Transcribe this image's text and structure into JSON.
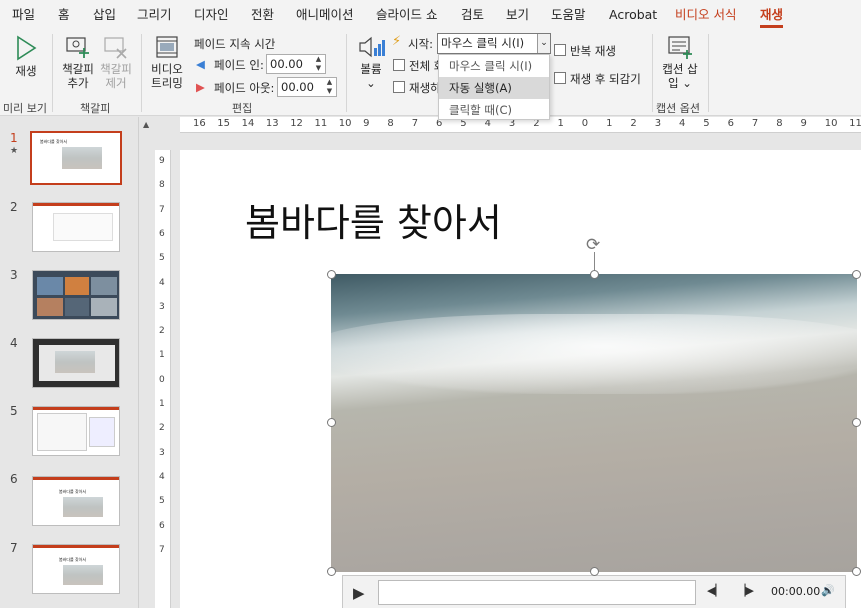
{
  "menu": {
    "tabs": [
      "파일",
      "홈",
      "삽입",
      "그리기",
      "디자인",
      "전환",
      "애니메이션",
      "슬라이드 쇼",
      "검토",
      "보기",
      "도움말",
      "Acrobat"
    ],
    "context_tab": "비디오 서식",
    "active_tab": "재생"
  },
  "ribbon": {
    "preview": {
      "play_label": "재생",
      "group": "미리 보기"
    },
    "bookmarks": {
      "add_label": "책갈피 추가",
      "remove_label": "책갈피 제거",
      "group": "책갈피"
    },
    "editing": {
      "trim_label": "비디오 트리밍",
      "fade_duration_label": "페이드 지속 시간",
      "fade_in_label": "페이드 인:",
      "fade_in_value": "00.00",
      "fade_out_label": "페이드 아웃:",
      "fade_out_value": "00.00",
      "group": "편집"
    },
    "video_options": {
      "volume_label": "볼륨",
      "start_label": "시작:",
      "start_value": "마우스 클릭 시(I)",
      "fullscreen_label": "전체 화",
      "hide_label": "재생하",
      "loop_label": "반복 재생",
      "rewind_label": "재생 후 되감기",
      "dropdown_options": [
        "마우스 클릭 시(I)",
        "자동 실행(A)",
        "클릭할 때(C)"
      ]
    },
    "captions": {
      "insert_label": "캡션 삽입",
      "group": "캡션 옵션"
    }
  },
  "thumbnails": [
    {
      "num": "1",
      "title": "봄바다를 찾아서",
      "selected": true
    },
    {
      "num": "2",
      "title": ""
    },
    {
      "num": "3",
      "title": ""
    },
    {
      "num": "4",
      "title": ""
    },
    {
      "num": "5",
      "title": ""
    },
    {
      "num": "6",
      "title": "봄바다를 찾아서"
    },
    {
      "num": "7",
      "title": "봄바다를 찾아서"
    }
  ],
  "ruler": {
    "h_ticks": [
      "16",
      "15",
      "14",
      "13",
      "12",
      "11",
      "10",
      "9",
      "8",
      "7",
      "6",
      "5",
      "4",
      "3",
      "2",
      "1",
      "0",
      "1",
      "2",
      "3",
      "4",
      "5",
      "6",
      "7",
      "8",
      "9",
      "10",
      "11"
    ],
    "v_ticks": [
      "9",
      "8",
      "7",
      "6",
      "5",
      "4",
      "3",
      "2",
      "1",
      "0",
      "1",
      "2",
      "3",
      "4",
      "5",
      "6",
      "7"
    ]
  },
  "slide": {
    "title": "봄바다를 찾아서"
  },
  "player": {
    "time": "00:00.00"
  },
  "colors": {
    "accent": "#c43e1c",
    "ribbon_bg": "#f3f3f3"
  }
}
